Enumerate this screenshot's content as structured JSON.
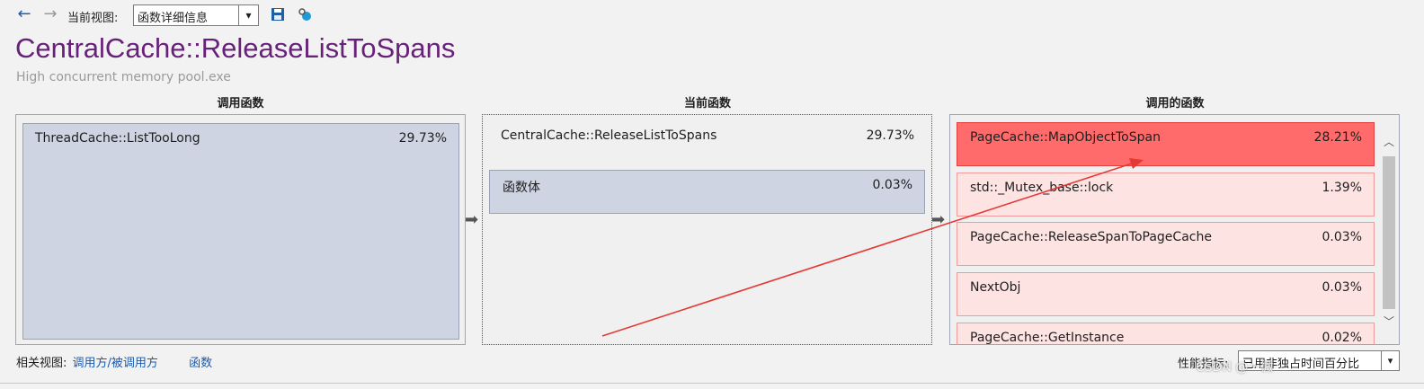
{
  "toolbar": {
    "back_icon": "arrow-left-icon",
    "forward_icon": "arrow-right-icon",
    "view_label": "当前视图:",
    "view_value": "函数详细信息",
    "save_icon": "save-icon",
    "settings_icon": "settings-icon"
  },
  "header": {
    "title": "CentralCache::ReleaseListToSpans",
    "subtitle": "High concurrent memory pool.exe"
  },
  "columns": {
    "callers": "调用函数",
    "current": "当前函数",
    "callees": "调用的函数"
  },
  "callers": [
    {
      "name": "ThreadCache::ListTooLong",
      "percent": "29.73%"
    }
  ],
  "current": {
    "name": "CentralCache::ReleaseListToSpans",
    "percent": "29.73%",
    "body": {
      "name": "函数体",
      "percent": "0.03%"
    }
  },
  "callees": [
    {
      "name": "PageCache::MapObjectToSpan",
      "percent": "28.21%"
    },
    {
      "name": "std::_Mutex_base::lock",
      "percent": "1.39%"
    },
    {
      "name": "PageCache::ReleaseSpanToPageCache",
      "percent": "0.03%"
    },
    {
      "name": "NextObj",
      "percent": "0.03%"
    },
    {
      "name": "PageCache::GetInstance",
      "percent": "0.02%"
    }
  ],
  "footer": {
    "related_label": "相关视图:",
    "link_callers": "调用方/被调用方",
    "link_functions": "函数",
    "metric_label": "性能指标:",
    "metric_value": "已用非独占时间百分比"
  },
  "watermark": "CSDN @一微·",
  "colors": {
    "title": "#68217a",
    "hot": "#ff6b6b",
    "callee": "#fee3e3",
    "caller": "#ced4e2",
    "annotation": "#e53935"
  }
}
